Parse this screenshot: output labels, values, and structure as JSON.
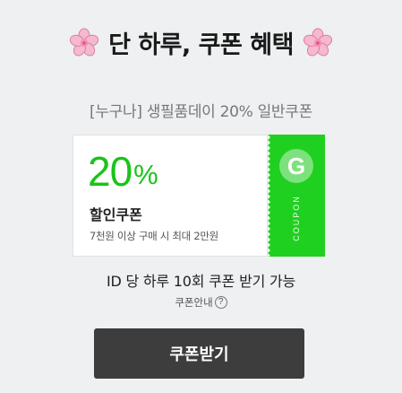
{
  "header": {
    "title": "단 하루, 쿠폰 혜택",
    "left_icon": "cherry-blossom-icon",
    "right_icon": "cherry-blossom-icon"
  },
  "subtitle": "[누구나] 생필품데이 20% 일반쿠폰",
  "coupon": {
    "discount_value": "20",
    "discount_unit": "%",
    "name": "할인쿠폰",
    "condition": "7천원 이상 구매 시 최대 2만원",
    "brand_letter": "G",
    "tab_label": "COUPON",
    "accent_color": "#19c419",
    "tab_color": "#20d020"
  },
  "limit_text": "ID 당 하루 10회 쿠폰 받기 가능",
  "guide": {
    "label": "쿠폰안내",
    "help_symbol": "?"
  },
  "download_button": {
    "label": "쿠폰받기",
    "color": "#3d3d3d"
  }
}
